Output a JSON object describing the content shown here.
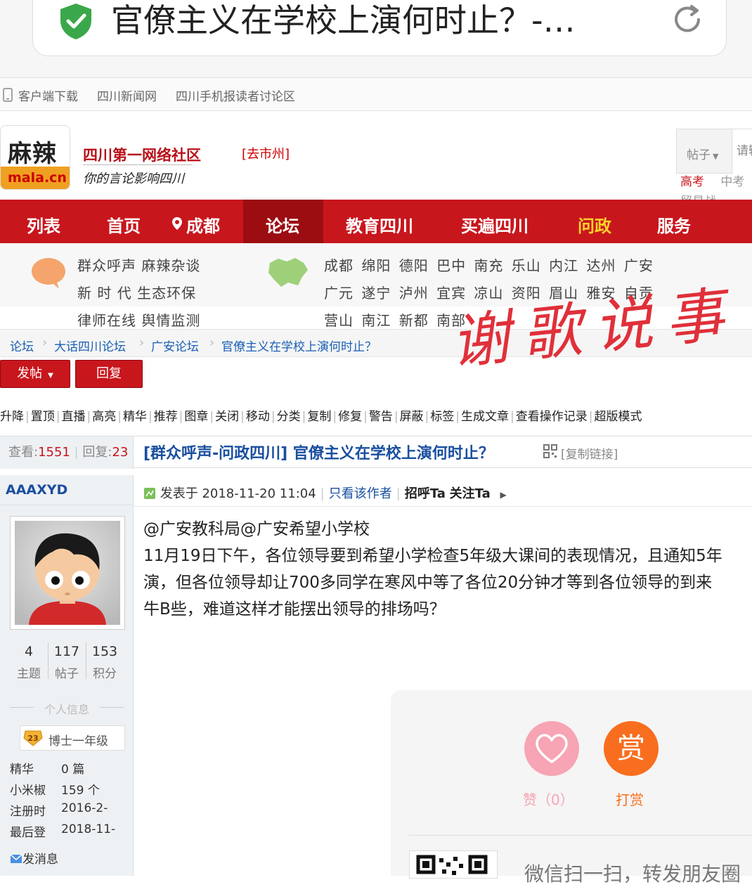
{
  "browser": {
    "url_title": "官僚主义在学校上演何时止？-…",
    "secure_icon": "shield-check-icon",
    "reload_icon": "reload-icon"
  },
  "topbar": {
    "items": [
      "客户端下载",
      "四川新闻网",
      "四川手机报读者讨论区"
    ]
  },
  "site": {
    "logo_cn": "麻辣",
    "logo_en": "mala.cn",
    "slogan_main": "四川第一网络社区",
    "slogan_sub": "你的言论影响四川",
    "city_link": "[去市州]",
    "search_type": "帖子",
    "search_placeholder": "请输",
    "hot_links": [
      "高考",
      "中考",
      "贸易战"
    ]
  },
  "nav": {
    "items": [
      "列表",
      "首页",
      "成都",
      "论坛",
      "教育四川",
      "买遍四川",
      "问政",
      "服务"
    ],
    "active": "论坛"
  },
  "subnav": {
    "left_rows": [
      "群众呼声 麻辣杂谈",
      "新 时 代 生态环保",
      "律师在线 舆情监测"
    ],
    "city_rows": [
      "成都 绵阳 德阳 巴中 南充 乐山 内江 达州 广安",
      "广元 遂宁 泸州 宜宾 凉山 资阳 眉山 雅安 自贡",
      "营山 南江 新都 南部"
    ]
  },
  "breadcrumb": [
    "论坛",
    "大话四川论坛",
    "广安论坛",
    "官僚主义在学校上演何时止？"
  ],
  "signature": "谢歌说事",
  "actions": {
    "post_label": "发帖",
    "reply_label": "回复"
  },
  "admin_tools": [
    "升降",
    "置顶",
    "直播",
    "高亮",
    "精华",
    "推荐",
    "图章",
    "关闭",
    "移动",
    "分类",
    "复制",
    "修复",
    "警告",
    "屏蔽",
    "标签",
    "生成文章",
    "查看操作记录",
    "超版模式"
  ],
  "thread": {
    "views_label": "查看:",
    "views": "1551",
    "replies_label": "回复:",
    "replies": "23",
    "title": "[群众呼声-问政四川] 官僚主义在学校上演何时止？",
    "copy_link": "[复制链接]"
  },
  "author": {
    "name": "AAAXYD",
    "stats": [
      {
        "value": "4",
        "label": "主题"
      },
      {
        "value": "117",
        "label": "帖子"
      },
      {
        "value": "153",
        "label": "积分"
      }
    ],
    "personal_info_label": "个人信息",
    "rank_level": "23",
    "rank": "博士一年级",
    "info": [
      {
        "label": "精华",
        "value": "0 篇"
      },
      {
        "label": "小米椒",
        "value": "159 个"
      },
      {
        "label": "注册时",
        "value": "2016-2-"
      },
      {
        "label": "最后登",
        "value": "2018-11-"
      }
    ],
    "send_message": "发消息"
  },
  "post": {
    "posted_at": "发表于 2018-11-20 11:04",
    "only_author": "只看该作者",
    "greet": "招呼Ta",
    "follow": "关注Ta",
    "lines": [
      "@广安教科局@广安希望小学校",
      "11月19日下午，各位领导要到希望小学检查5年级大课间的表现情况，且通知5年",
      "演，但各位领导却让700多同学在寒风中等了各位20分钟才等到各位领导的到来",
      "牛B些，难道这样才能摆出领导的排场吗？"
    ]
  },
  "reward": {
    "like_label": "赞（0）",
    "reward_glyph": "赏",
    "reward_label": "打赏",
    "share_text": "微信扫一扫，转发朋友圈"
  },
  "colors": {
    "brand_red": "#c8161d",
    "link_blue": "#1a4fa0",
    "reward_orange": "#f86e1e",
    "like_pink": "#f7a4b4"
  }
}
